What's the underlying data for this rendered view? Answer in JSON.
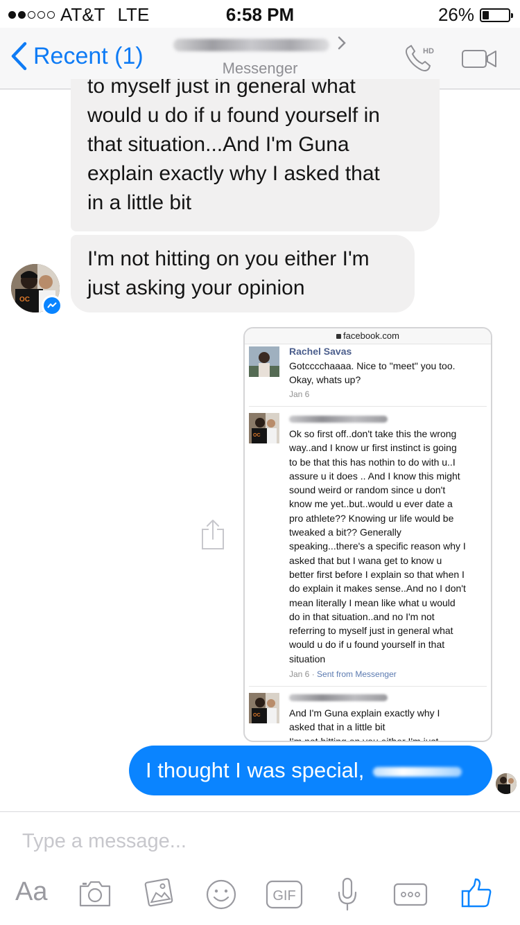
{
  "status_bar": {
    "signal_filled": 2,
    "signal_total": 5,
    "carrier": "AT&T",
    "network": "LTE",
    "time": "6:58 PM",
    "battery_percent": "26%",
    "battery_level": 0.26
  },
  "header": {
    "back_label": "Recent (1)",
    "subtitle": "Messenger",
    "accent_color": "#0e7bf5",
    "phone_badge": "HD",
    "icons": [
      "back-chevron-icon",
      "chevron-right-icon",
      "phone-hd-icon",
      "video-camera-icon"
    ]
  },
  "messages": {
    "received_1": {
      "clipped_top": "to myself just in general what",
      "lines": [
        "would u do if u found yourself in",
        "that situation...And I'm Guna",
        "explain exactly why I asked that",
        "in a little bit"
      ]
    },
    "received_2": {
      "lines": [
        "I'm not hitting on you either I'm",
        "just asking your opinion"
      ]
    },
    "screenshot": {
      "url": "facebook.com",
      "msg1": {
        "name": "Rachel Savas",
        "lines": [
          "Gotcccchaaaa. Nice to \"meet\" you too.",
          "Okay, whats up?"
        ],
        "meta": "Jan 6"
      },
      "msg2": {
        "lines": [
          "Ok so first off..don't take this the wrong",
          "way..and I know ur first instinct is going",
          "to be that this has nothin to do with u..I",
          "assure u it does .. And I know this might",
          "sound weird or random since u don't",
          "know me yet..but..would u ever date a",
          "pro athlete?? Knowing ur life would be",
          "tweaked a bit?? Generally",
          "speaking...there's a specific reason why I",
          "asked that but I wana get to know u",
          "better first before I explain so that when I",
          "do explain it makes sense..And no I don't",
          "mean literally I mean like what u would",
          "do in that situation..and no I'm not",
          "referring to myself just in general what",
          "would u do if u found yourself in that",
          "situation"
        ],
        "meta_date": "Jan 6 · ",
        "meta_source": "Sent from Messenger"
      },
      "msg3": {
        "lines": [
          "And I'm Guna explain exactly why I",
          "asked that in a little bit",
          "I'm not hitting on you either I'm just"
        ]
      }
    },
    "sent": {
      "text": "I thought I was special, ",
      "color": "#0a84ff"
    }
  },
  "composer": {
    "placeholder": "Type a message...",
    "aa_label": "Aa",
    "gif_label": "GIF",
    "tools": [
      "text-size-icon",
      "camera-icon",
      "photo-gallery-icon",
      "emoji-icon",
      "gif-icon",
      "microphone-icon",
      "more-icon",
      "like-icon"
    ]
  }
}
